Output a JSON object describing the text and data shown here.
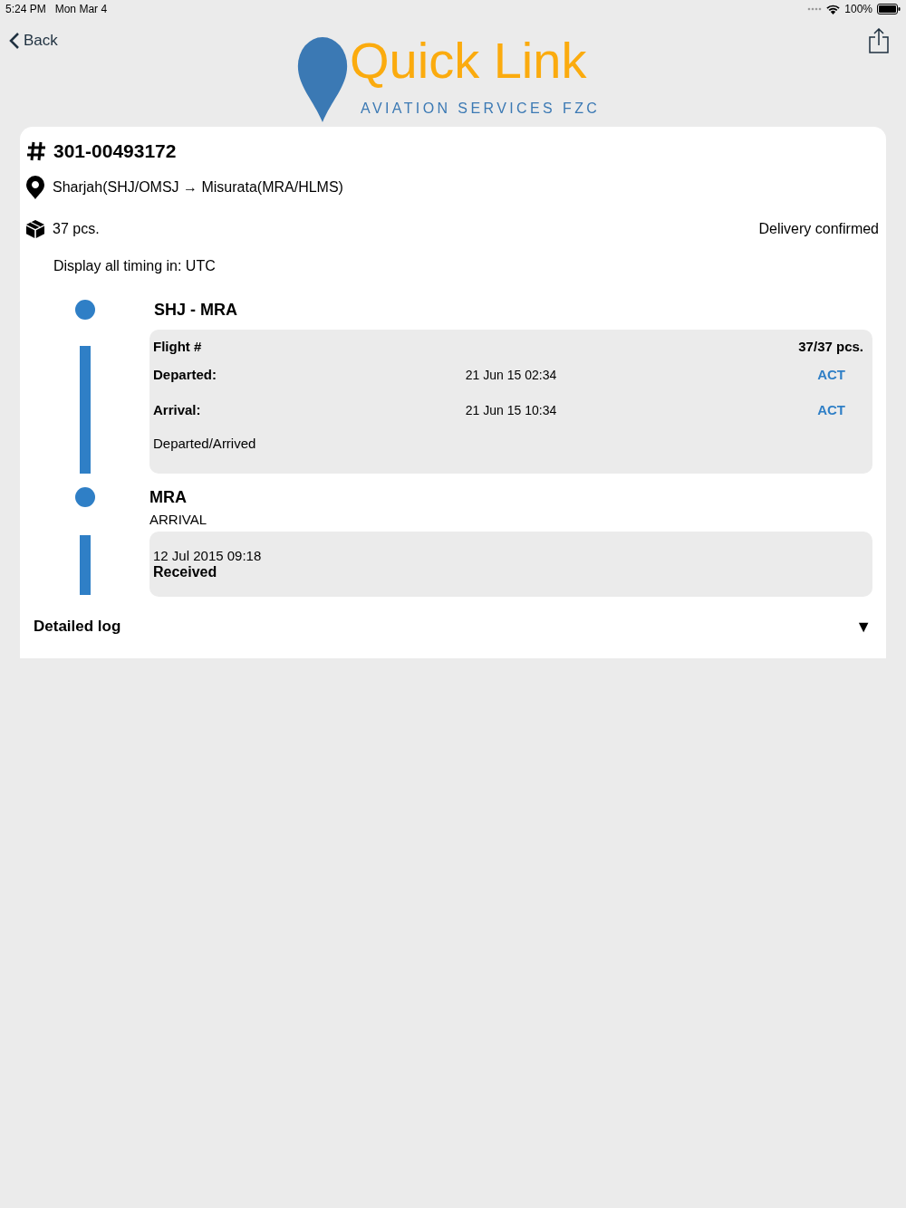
{
  "status_bar": {
    "time": "5:24 PM",
    "date": "Mon Mar 4",
    "battery": "100%"
  },
  "nav": {
    "back": "Back"
  },
  "logo": {
    "name": "Quick Link",
    "tagline": "AVIATION SERVICES FZC"
  },
  "shipment": {
    "number": "301-00493172",
    "route": "Sharjah(SHJ/OMSJ → Misurata(MRA/HLMS)",
    "pieces": "37 pcs.",
    "status": "Delivery confirmed",
    "timezone": "Display all timing in: UTC"
  },
  "timeline": [
    {
      "kind": "leg",
      "title": "SHJ - MRA",
      "flight_label": "Flight #",
      "pieces": "37/37 pcs.",
      "rows": [
        {
          "label": "Departed:",
          "time": "21 Jun 15 02:34",
          "tag": "ACT"
        },
        {
          "label": "Arrival:",
          "time": "21 Jun 15 10:34",
          "tag": "ACT"
        }
      ],
      "note": "Departed/Arrived"
    },
    {
      "kind": "event",
      "title": "MRA",
      "subtitle": "ARRIVAL",
      "time": "12 Jul 2015 09:18",
      "status": "Received"
    }
  ],
  "detailed_log": {
    "label": "Detailed log",
    "toggle": "▼",
    "expanded": false
  }
}
